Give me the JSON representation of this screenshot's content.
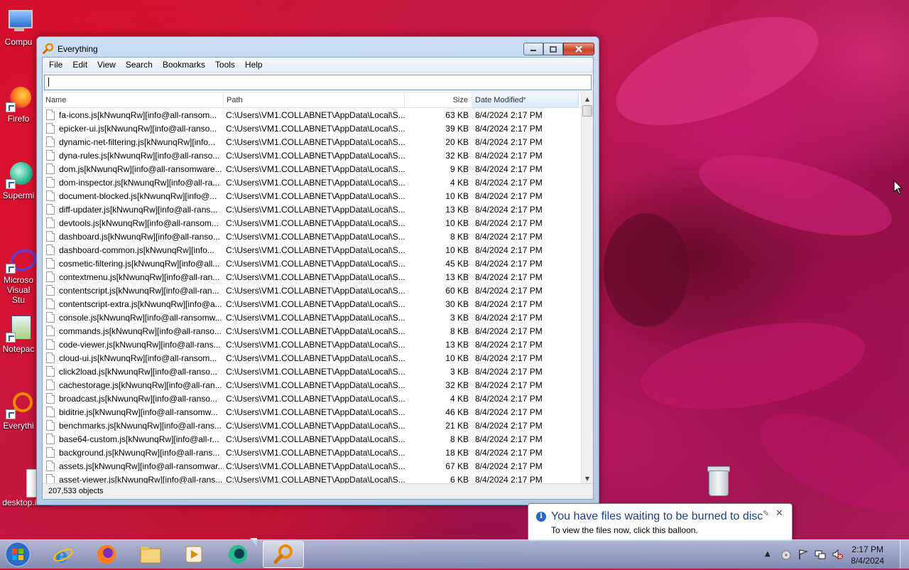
{
  "desktop": {
    "icons": [
      {
        "label": "Compu",
        "icon": "computer-icon"
      },
      {
        "label": "Firefo",
        "icon": "firefox-icon"
      },
      {
        "label": "Supermi",
        "icon": "supermium-icon"
      },
      {
        "label": "Microso Visual Stu",
        "icon": "visual-studio-icon"
      },
      {
        "label": "Notepac",
        "icon": "notepad-icon"
      },
      {
        "label": "Everythi",
        "icon": "everything-icon"
      },
      {
        "label": "desktop.ini...",
        "icon": "file-icon"
      }
    ]
  },
  "window": {
    "title": "Everything",
    "menu": [
      "File",
      "Edit",
      "View",
      "Search",
      "Bookmarks",
      "Tools",
      "Help"
    ],
    "search": {
      "value": ""
    },
    "columns": {
      "name": "Name",
      "path": "Path",
      "size": "Size",
      "date": "Date Modified"
    },
    "rows": [
      {
        "name": "fa-icons.js[kNwunqRw][info@all-ransom...",
        "path": "C:\\Users\\VM1.COLLABNET\\AppData\\Local\\S...",
        "size": "63 KB",
        "date": "8/4/2024 2:17 PM"
      },
      {
        "name": "epicker-ui.js[kNwunqRw][info@all-ranso...",
        "path": "C:\\Users\\VM1.COLLABNET\\AppData\\Local\\S...",
        "size": "39 KB",
        "date": "8/4/2024 2:17 PM"
      },
      {
        "name": "dynamic-net-filtering.js[kNwunqRw][info...",
        "path": "C:\\Users\\VM1.COLLABNET\\AppData\\Local\\S...",
        "size": "20 KB",
        "date": "8/4/2024 2:17 PM"
      },
      {
        "name": "dyna-rules.js[kNwunqRw][info@all-ranso...",
        "path": "C:\\Users\\VM1.COLLABNET\\AppData\\Local\\S...",
        "size": "32 KB",
        "date": "8/4/2024 2:17 PM"
      },
      {
        "name": "dom.js[kNwunqRw][info@all-ransomware...",
        "path": "C:\\Users\\VM1.COLLABNET\\AppData\\Local\\S...",
        "size": "9 KB",
        "date": "8/4/2024 2:17 PM"
      },
      {
        "name": "dom-inspector.js[kNwunqRw][info@all-ra...",
        "path": "C:\\Users\\VM1.COLLABNET\\AppData\\Local\\S...",
        "size": "4 KB",
        "date": "8/4/2024 2:17 PM"
      },
      {
        "name": "document-blocked.js[kNwunqRw][info@...",
        "path": "C:\\Users\\VM1.COLLABNET\\AppData\\Local\\S...",
        "size": "10 KB",
        "date": "8/4/2024 2:17 PM"
      },
      {
        "name": "diff-updater.js[kNwunqRw][info@all-rans...",
        "path": "C:\\Users\\VM1.COLLABNET\\AppData\\Local\\S...",
        "size": "13 KB",
        "date": "8/4/2024 2:17 PM"
      },
      {
        "name": "devtools.js[kNwunqRw][info@all-ransom...",
        "path": "C:\\Users\\VM1.COLLABNET\\AppData\\Local\\S...",
        "size": "10 KB",
        "date": "8/4/2024 2:17 PM"
      },
      {
        "name": "dashboard.js[kNwunqRw][info@all-ranso...",
        "path": "C:\\Users\\VM1.COLLABNET\\AppData\\Local\\S...",
        "size": "8 KB",
        "date": "8/4/2024 2:17 PM"
      },
      {
        "name": "dashboard-common.js[kNwunqRw][info...",
        "path": "C:\\Users\\VM1.COLLABNET\\AppData\\Local\\S...",
        "size": "10 KB",
        "date": "8/4/2024 2:17 PM"
      },
      {
        "name": "cosmetic-filtering.js[kNwunqRw][info@all...",
        "path": "C:\\Users\\VM1.COLLABNET\\AppData\\Local\\S...",
        "size": "45 KB",
        "date": "8/4/2024 2:17 PM"
      },
      {
        "name": "contextmenu.js[kNwunqRw][info@all-ran...",
        "path": "C:\\Users\\VM1.COLLABNET\\AppData\\Local\\S...",
        "size": "13 KB",
        "date": "8/4/2024 2:17 PM"
      },
      {
        "name": "contentscript.js[kNwunqRw][info@all-ran...",
        "path": "C:\\Users\\VM1.COLLABNET\\AppData\\Local\\S...",
        "size": "60 KB",
        "date": "8/4/2024 2:17 PM"
      },
      {
        "name": "contentscript-extra.js[kNwunqRw][info@a...",
        "path": "C:\\Users\\VM1.COLLABNET\\AppData\\Local\\S...",
        "size": "30 KB",
        "date": "8/4/2024 2:17 PM"
      },
      {
        "name": "console.js[kNwunqRw][info@all-ransomw...",
        "path": "C:\\Users\\VM1.COLLABNET\\AppData\\Local\\S...",
        "size": "3 KB",
        "date": "8/4/2024 2:17 PM"
      },
      {
        "name": "commands.js[kNwunqRw][info@all-ranso...",
        "path": "C:\\Users\\VM1.COLLABNET\\AppData\\Local\\S...",
        "size": "8 KB",
        "date": "8/4/2024 2:17 PM"
      },
      {
        "name": "code-viewer.js[kNwunqRw][info@all-rans...",
        "path": "C:\\Users\\VM1.COLLABNET\\AppData\\Local\\S...",
        "size": "13 KB",
        "date": "8/4/2024 2:17 PM"
      },
      {
        "name": "cloud-ui.js[kNwunqRw][info@all-ransom...",
        "path": "C:\\Users\\VM1.COLLABNET\\AppData\\Local\\S...",
        "size": "10 KB",
        "date": "8/4/2024 2:17 PM"
      },
      {
        "name": "click2load.js[kNwunqRw][info@all-ranso...",
        "path": "C:\\Users\\VM1.COLLABNET\\AppData\\Local\\S...",
        "size": "3 KB",
        "date": "8/4/2024 2:17 PM"
      },
      {
        "name": "cachestorage.js[kNwunqRw][info@all-ran...",
        "path": "C:\\Users\\VM1.COLLABNET\\AppData\\Local\\S...",
        "size": "32 KB",
        "date": "8/4/2024 2:17 PM"
      },
      {
        "name": "broadcast.js[kNwunqRw][info@all-ranso...",
        "path": "C:\\Users\\VM1.COLLABNET\\AppData\\Local\\S...",
        "size": "4 KB",
        "date": "8/4/2024 2:17 PM"
      },
      {
        "name": "biditrie.js[kNwunqRw][info@all-ransomw...",
        "path": "C:\\Users\\VM1.COLLABNET\\AppData\\Local\\S...",
        "size": "46 KB",
        "date": "8/4/2024 2:17 PM"
      },
      {
        "name": "benchmarks.js[kNwunqRw][info@all-rans...",
        "path": "C:\\Users\\VM1.COLLABNET\\AppData\\Local\\S...",
        "size": "21 KB",
        "date": "8/4/2024 2:17 PM"
      },
      {
        "name": "base64-custom.js[kNwunqRw][info@all-r...",
        "path": "C:\\Users\\VM1.COLLABNET\\AppData\\Local\\S...",
        "size": "8 KB",
        "date": "8/4/2024 2:17 PM"
      },
      {
        "name": "background.js[kNwunqRw][info@all-rans...",
        "path": "C:\\Users\\VM1.COLLABNET\\AppData\\Local\\S...",
        "size": "18 KB",
        "date": "8/4/2024 2:17 PM"
      },
      {
        "name": "assets.js[kNwunqRw][info@all-ransomwar...",
        "path": "C:\\Users\\VM1.COLLABNET\\AppData\\Local\\S...",
        "size": "67 KB",
        "date": "8/4/2024 2:17 PM"
      },
      {
        "name": "asset-viewer.js[kNwunqRw][info@all-rans...",
        "path": "C:\\Users\\VM1.COLLABNET\\AppData\\Local\\S...",
        "size": "6 KB",
        "date": "8/4/2024 2:17 PM"
      }
    ],
    "status": "207,533 objects"
  },
  "balloon": {
    "title": "You have files waiting to be burned to disc",
    "text": "To view the files now, click this balloon."
  },
  "taskbar": {
    "apps": [
      "internet-explorer-icon",
      "firefox-icon",
      "file-explorer-icon",
      "media-player-icon",
      "supermium-icon",
      "everything-icon"
    ],
    "clock_time": "2:17 PM",
    "clock_date": "8/4/2024"
  }
}
